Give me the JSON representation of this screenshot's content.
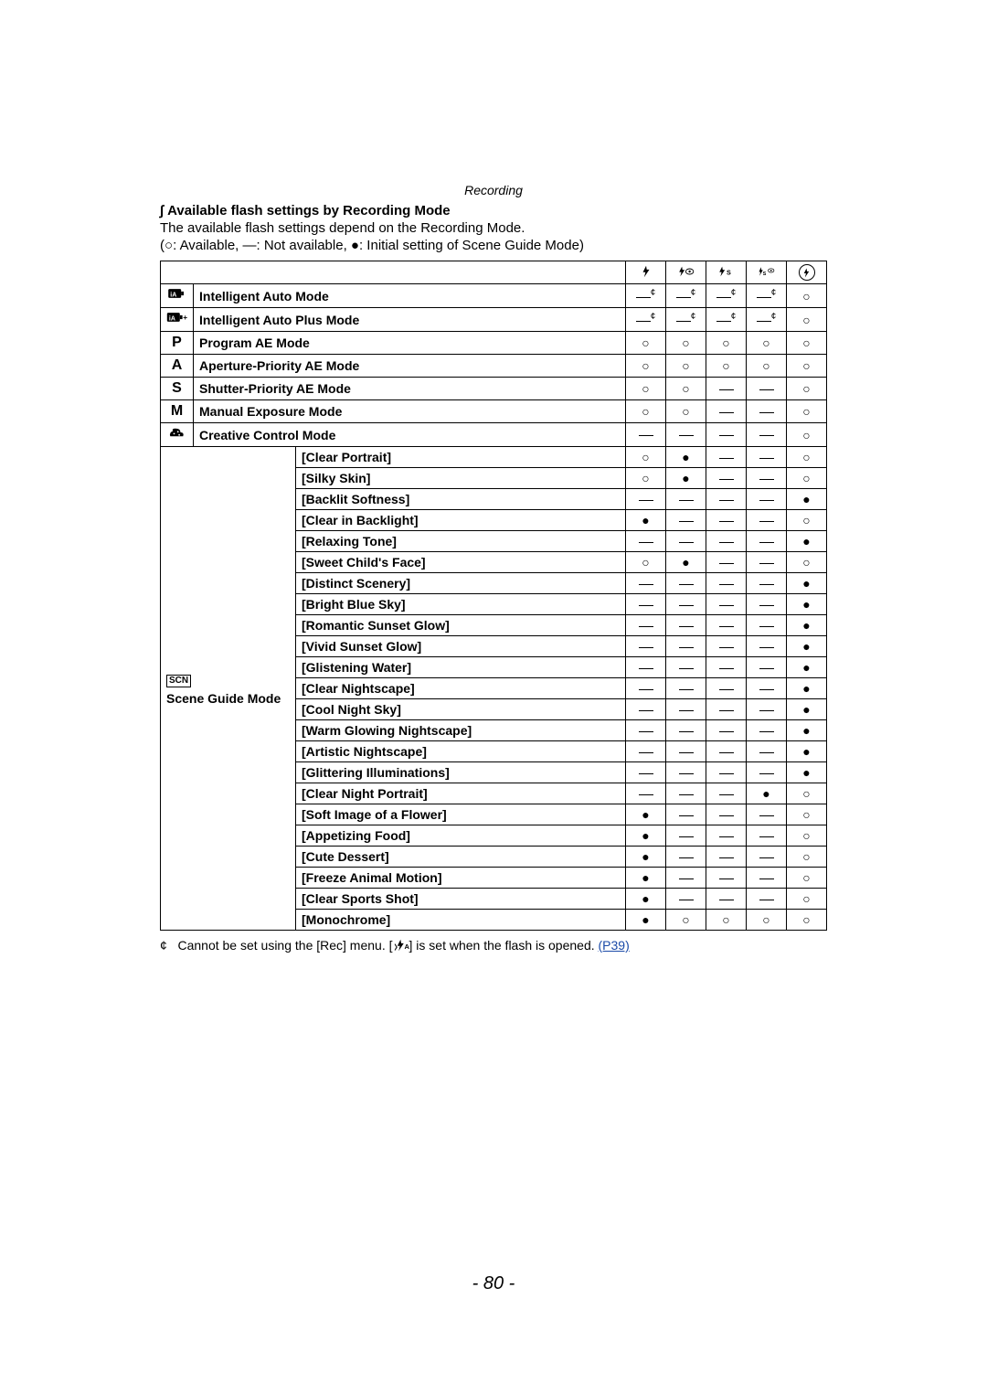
{
  "section_label": "Recording",
  "heading_prefix": "∫",
  "heading": "Available flash settings by Recording Mode",
  "intro": "The available flash settings depend on the Recording Mode.",
  "legend_prefix": "(",
  "legend_avail_sym": "○",
  "legend_avail_txt": ": Available, ",
  "legend_na_sym": "—",
  "legend_na_txt": ":  Not available, ",
  "legend_init_sym": "●",
  "legend_init_txt": ": Initial setting of Scene Guide Mode)",
  "columns": [
    "flash-forced",
    "flash-redeye",
    "flash-slow",
    "flash-slow-redeye",
    "flash-off"
  ],
  "footnote_mark": "¢",
  "footnote_text_1": "Cannot be set using the [Rec] menu. [",
  "footnote_text_2": "] is set when the flash is opened. ",
  "footnote_link": "(P39)",
  "page_num": "- 80 -",
  "scene_group_icon": "SCN",
  "scene_group_label": "Scene Guide Mode",
  "chart_data": {
    "type": "table",
    "legend": {
      "○": "Available",
      "—": "Not available",
      "●": "Initial setting of Scene Guide Mode",
      "—¢": "Not available (see footnote)"
    },
    "columns": [
      "Flash Forced On",
      "Forced On / Red-Eye",
      "Slow Sync.",
      "Slow Sync. / Red-Eye",
      "Forced Off"
    ],
    "rows": [
      {
        "group": "mode",
        "icon": "iA",
        "label": "Intelligent Auto Mode",
        "values": [
          "—¢",
          "—¢",
          "—¢",
          "—¢",
          "○"
        ]
      },
      {
        "group": "mode",
        "icon": "iA+",
        "label": "Intelligent Auto Plus Mode",
        "values": [
          "—¢",
          "—¢",
          "—¢",
          "—¢",
          "○"
        ]
      },
      {
        "group": "mode",
        "icon": "P",
        "label": "Program AE Mode",
        "values": [
          "○",
          "○",
          "○",
          "○",
          "○"
        ]
      },
      {
        "group": "mode",
        "icon": "A",
        "label": "Aperture-Priority AE Mode",
        "values": [
          "○",
          "○",
          "○",
          "○",
          "○"
        ]
      },
      {
        "group": "mode",
        "icon": "S",
        "label": "Shutter-Priority AE Mode",
        "values": [
          "○",
          "○",
          "—",
          "—",
          "○"
        ]
      },
      {
        "group": "mode",
        "icon": "M",
        "label": "Manual Exposure Mode",
        "values": [
          "○",
          "○",
          "—",
          "—",
          "○"
        ]
      },
      {
        "group": "mode",
        "icon": "creative",
        "label": "Creative Control Mode",
        "values": [
          "—",
          "—",
          "—",
          "—",
          "○"
        ]
      },
      {
        "group": "scene",
        "label": "[Clear Portrait]",
        "values": [
          "○",
          "●",
          "—",
          "—",
          "○"
        ]
      },
      {
        "group": "scene",
        "label": "[Silky Skin]",
        "values": [
          "○",
          "●",
          "—",
          "—",
          "○"
        ]
      },
      {
        "group": "scene",
        "label": "[Backlit Softness]",
        "values": [
          "—",
          "—",
          "—",
          "—",
          "●"
        ]
      },
      {
        "group": "scene",
        "label": "[Clear in Backlight]",
        "values": [
          "●",
          "—",
          "—",
          "—",
          "○"
        ]
      },
      {
        "group": "scene",
        "label": "[Relaxing Tone]",
        "values": [
          "—",
          "—",
          "—",
          "—",
          "●"
        ]
      },
      {
        "group": "scene",
        "label": "[Sweet Child's Face]",
        "values": [
          "○",
          "●",
          "—",
          "—",
          "○"
        ]
      },
      {
        "group": "scene",
        "label": "[Distinct Scenery]",
        "values": [
          "—",
          "—",
          "—",
          "—",
          "●"
        ]
      },
      {
        "group": "scene",
        "label": "[Bright Blue Sky]",
        "values": [
          "—",
          "—",
          "—",
          "—",
          "●"
        ]
      },
      {
        "group": "scene",
        "label": "[Romantic Sunset Glow]",
        "values": [
          "—",
          "—",
          "—",
          "—",
          "●"
        ]
      },
      {
        "group": "scene",
        "label": "[Vivid Sunset Glow]",
        "values": [
          "—",
          "—",
          "—",
          "—",
          "●"
        ]
      },
      {
        "group": "scene",
        "label": "[Glistening Water]",
        "values": [
          "—",
          "—",
          "—",
          "—",
          "●"
        ]
      },
      {
        "group": "scene",
        "label": "[Clear Nightscape]",
        "values": [
          "—",
          "—",
          "—",
          "—",
          "●"
        ]
      },
      {
        "group": "scene",
        "label": "[Cool Night Sky]",
        "values": [
          "—",
          "—",
          "—",
          "—",
          "●"
        ]
      },
      {
        "group": "scene",
        "label": "[Warm Glowing Nightscape]",
        "values": [
          "—",
          "—",
          "—",
          "—",
          "●"
        ]
      },
      {
        "group": "scene",
        "label": "[Artistic Nightscape]",
        "values": [
          "—",
          "—",
          "—",
          "—",
          "●"
        ]
      },
      {
        "group": "scene",
        "label": "[Glittering Illuminations]",
        "values": [
          "—",
          "—",
          "—",
          "—",
          "●"
        ]
      },
      {
        "group": "scene",
        "label": "[Clear Night Portrait]",
        "values": [
          "—",
          "—",
          "—",
          "●",
          "○"
        ]
      },
      {
        "group": "scene",
        "label": "[Soft Image of a Flower]",
        "values": [
          "●",
          "—",
          "—",
          "—",
          "○"
        ]
      },
      {
        "group": "scene",
        "label": "[Appetizing Food]",
        "values": [
          "●",
          "—",
          "—",
          "—",
          "○"
        ]
      },
      {
        "group": "scene",
        "label": "[Cute Dessert]",
        "values": [
          "●",
          "—",
          "—",
          "—",
          "○"
        ]
      },
      {
        "group": "scene",
        "label": "[Freeze Animal Motion]",
        "values": [
          "●",
          "—",
          "—",
          "—",
          "○"
        ]
      },
      {
        "group": "scene",
        "label": "[Clear Sports Shot]",
        "values": [
          "●",
          "—",
          "—",
          "—",
          "○"
        ]
      },
      {
        "group": "scene",
        "label": "[Monochrome]",
        "values": [
          "●",
          "○",
          "○",
          "○",
          "○"
        ]
      }
    ]
  }
}
